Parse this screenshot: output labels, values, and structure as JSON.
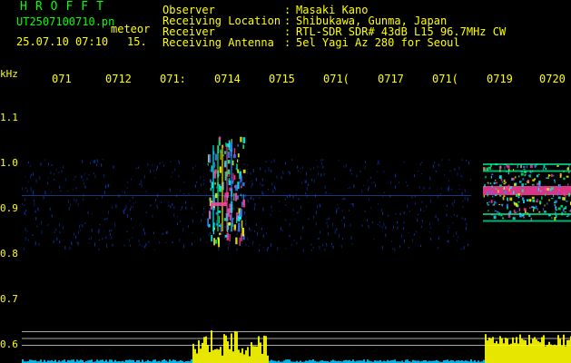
{
  "header": {
    "app_title": "HROFFT",
    "filename": "UT2507100710.pn",
    "meteor_label": "meteor",
    "datetime": "25.07.10 07:10",
    "count": "15."
  },
  "station": [
    {
      "label": "Observer",
      "value": "Masaki Kano"
    },
    {
      "label": "Receiving Location",
      "value": "Shibukawa, Gunma, Japan"
    },
    {
      "label": "Receiver",
      "value": "RTL-SDR SDR# 43dB L15 96.7MHz CW"
    },
    {
      "label": "Receiving Antenna",
      "value": "5el Yagi Az 280 for Seoul"
    }
  ],
  "colon": ":",
  "colors": {
    "header_green": "#00ff00",
    "text_yellow": "#ffff00",
    "text_white": "#ffffff",
    "background": "#000000",
    "echo_core": "#ff3fa0",
    "spectrum_yellow": "#ffff00",
    "noise_cyan": "#00c8ff"
  },
  "chart_data": {
    "type": "heatmap",
    "ylabel": "kHz",
    "y_ticks": [
      "1.1",
      "1.0",
      "0.9",
      "0.8",
      "0.7",
      "0.6"
    ],
    "ylim": [
      0.55,
      1.15
    ],
    "x_ticks": [
      "071",
      "0712",
      "071:",
      "0714",
      "0715",
      "071(",
      "0717",
      "071(",
      "0719",
      "0720"
    ],
    "events": [
      {
        "kind": "meteor_burst",
        "minute_index": 3.4,
        "freq_low": 0.82,
        "freq_high": 1.05,
        "core_freq": 0.9
      },
      {
        "kind": "continuous_carrier",
        "minute_index_start": 8.2,
        "minute_index_end": 9.9,
        "core_freq": 0.93,
        "freq_low": 0.87,
        "freq_high": 0.99
      }
    ],
    "reference_lines_khz": [
      0.62,
      0.605,
      0.59
    ]
  }
}
